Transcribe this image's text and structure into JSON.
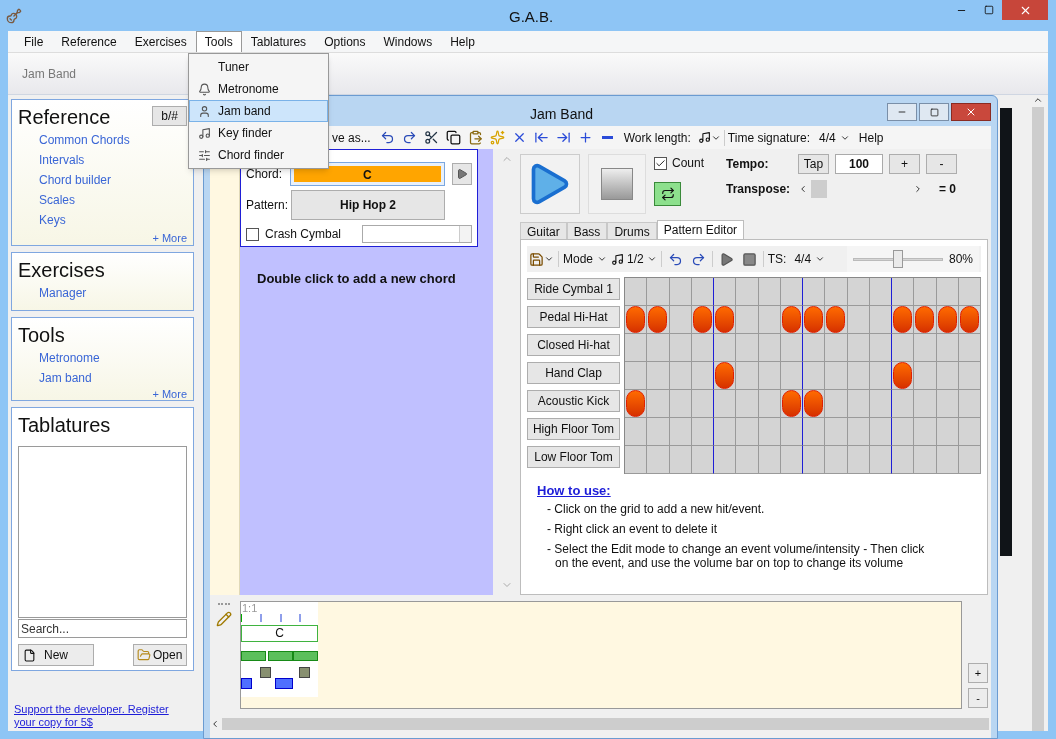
{
  "window": {
    "title": "G.A.B."
  },
  "menu_bar": [
    {
      "label": "File",
      "selected": false
    },
    {
      "label": "Reference",
      "selected": false
    },
    {
      "label": "Exercises",
      "selected": false
    },
    {
      "label": "Tools",
      "selected": true
    },
    {
      "label": "Tablatures",
      "selected": false
    },
    {
      "label": "Options",
      "selected": false
    },
    {
      "label": "Windows",
      "selected": false
    },
    {
      "label": "Help",
      "selected": false
    }
  ],
  "tools_menu": [
    {
      "label": "Tuner",
      "selected": false
    },
    {
      "label": "Metronome",
      "selected": false
    },
    {
      "label": "Jam band",
      "selected": true
    },
    {
      "label": "Key finder",
      "selected": false
    },
    {
      "label": "Chord finder",
      "selected": false
    }
  ],
  "toolbar": {
    "title": "Jam Band"
  },
  "sidebar": {
    "reference": {
      "title": "Reference",
      "toggle": "b/#",
      "items": [
        "Common Chords",
        "Intervals",
        "Chord builder",
        "Scales",
        "Keys"
      ],
      "more": "+ More"
    },
    "exercises": {
      "title": "Exercises",
      "items": [
        "Manager"
      ]
    },
    "tools": {
      "title": "Tools",
      "items": [
        "Metronome",
        "Jam band"
      ],
      "more": "+ More"
    },
    "tablatures": {
      "title": "Tablatures",
      "search_placeholder": "Search...",
      "new": "New",
      "open": "Open"
    },
    "support_link": "Support the developer. Register your copy for 5$"
  },
  "jam_band": {
    "title": "Jam Band",
    "toolbar": {
      "save_as": "ve as...",
      "work_length_label": "Work length:",
      "time_signature_label": "Time signature:",
      "time_signature": "4/4",
      "help": "Help"
    },
    "chord_panel": {
      "chord_label": "Chord:",
      "chord": "C",
      "pattern_label": "Pattern:",
      "pattern": "Hip Hop 2",
      "crash_label": "Crash Cymbal",
      "crash_checked": false
    },
    "hint": "Double click to add a new chord",
    "transport": {
      "count_label": "Count",
      "count_checked": true,
      "loop_on": true,
      "tempo_label": "Tempo:",
      "tap": "Tap",
      "tempo": "100",
      "plus": "+",
      "minus": "-",
      "transpose_label": "Transpose:",
      "transpose": {
        "level": 0.1,
        "value": "= 0"
      }
    },
    "tabs": [
      {
        "label": "Guitar",
        "selected": false
      },
      {
        "label": "Bass",
        "selected": false
      },
      {
        "label": "Drums",
        "selected": false
      },
      {
        "label": "Pattern Editor",
        "selected": true
      }
    ],
    "pattern_editor": {
      "mode": "Mode",
      "note_value": "1/2",
      "ts_label": "TS:",
      "ts": "4/4",
      "volume": {
        "level": 0.5,
        "reading": "80%"
      },
      "rows": [
        {
          "name": "Ride Cymbal 1",
          "steps": [
            false,
            false,
            false,
            false,
            false,
            false,
            false,
            false,
            false,
            false,
            false,
            false,
            false,
            false,
            false,
            false
          ]
        },
        {
          "name": "Pedal Hi-Hat",
          "steps": [
            true,
            true,
            false,
            true,
            true,
            false,
            false,
            true,
            true,
            true,
            false,
            false,
            true,
            true,
            true,
            true
          ]
        },
        {
          "name": "Closed Hi-hat",
          "steps": [
            false,
            false,
            false,
            false,
            false,
            false,
            false,
            false,
            false,
            false,
            false,
            false,
            false,
            false,
            false,
            false
          ]
        },
        {
          "name": "Hand Clap",
          "steps": [
            false,
            false,
            false,
            false,
            true,
            false,
            false,
            false,
            false,
            false,
            false,
            false,
            true,
            false,
            false,
            false
          ]
        },
        {
          "name": "Acoustic Kick",
          "steps": [
            true,
            false,
            false,
            false,
            false,
            false,
            false,
            true,
            true,
            false,
            false,
            false,
            false,
            false,
            false,
            false
          ]
        },
        {
          "name": "High Floor Tom",
          "steps": [
            false,
            false,
            false,
            false,
            false,
            false,
            false,
            false,
            false,
            false,
            false,
            false,
            false,
            false,
            false,
            false
          ]
        },
        {
          "name": "Low Floor Tom",
          "steps": [
            false,
            false,
            false,
            false,
            false,
            false,
            false,
            false,
            false,
            false,
            false,
            false,
            false,
            false,
            false,
            false
          ]
        }
      ]
    },
    "how_to": {
      "title": "How to use:",
      "lines": [
        "- Click on the grid to add a new hit/event.",
        "- Right click an event to delete it",
        "- Select the Edit mode to change an event volume/intensity - Then click on the event, and use the volume bar on top to change its volume"
      ]
    },
    "timeline": {
      "position": "1:1",
      "chord": "C",
      "zoom_in": "+",
      "zoom_out": "-"
    }
  }
}
